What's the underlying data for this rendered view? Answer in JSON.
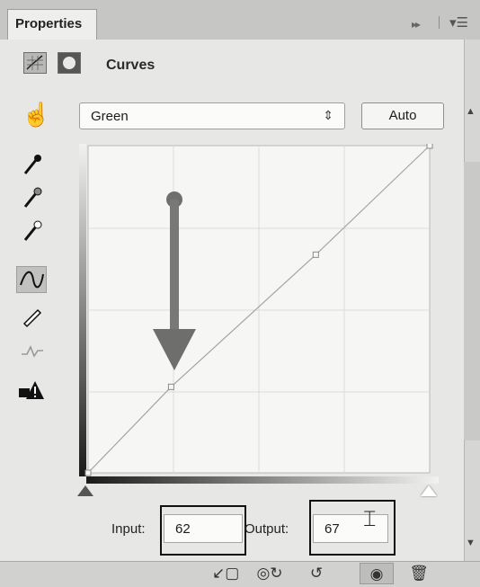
{
  "tab": {
    "title": "Properties"
  },
  "titlebar_icons": {
    "expand": "▸▸",
    "menu": "▾☰"
  },
  "header": {
    "title": "Curves",
    "icons": [
      "curves-adjustment-icon",
      "mask-icon"
    ]
  },
  "channel": {
    "value": "Green",
    "caret": "⇕",
    "auto_label": "Auto"
  },
  "tools": [
    {
      "name": "on-image-adjust-icon",
      "glyph": "☝",
      "active": false
    },
    {
      "name": "black-point-eyedropper-icon",
      "glyph": "✎",
      "active": false
    },
    {
      "name": "gray-point-eyedropper-icon",
      "glyph": "✎",
      "active": false
    },
    {
      "name": "white-point-eyedropper-icon",
      "glyph": "✎",
      "active": false
    },
    {
      "name": "edit-points-curve-icon",
      "glyph": "∿",
      "active": true
    },
    {
      "name": "draw-pencil-icon",
      "glyph": "✏",
      "active": false
    },
    {
      "name": "smooth-curve-icon",
      "glyph": "⌇",
      "active": false
    },
    {
      "name": "clipping-warning-icon",
      "glyph": "⚠",
      "active": false
    }
  ],
  "curve": {
    "points": [
      [
        0,
        0
      ],
      [
        62,
        67
      ],
      [
        170,
        170
      ],
      [
        255,
        255
      ]
    ],
    "selected_point": [
      62,
      67
    ]
  },
  "io": {
    "input_label": "Input:",
    "input_value": "62",
    "output_label": "Output:",
    "output_value": "67"
  },
  "bottom_icons": [
    "clip-to-layer-icon",
    "view-previous-state-icon",
    "reset-icon",
    "toggle-visibility-icon",
    "delete-icon"
  ],
  "colors": {
    "panel": "#e7e7e5",
    "arrow": "#7a7a78",
    "curve": "#a4a4a2"
  }
}
